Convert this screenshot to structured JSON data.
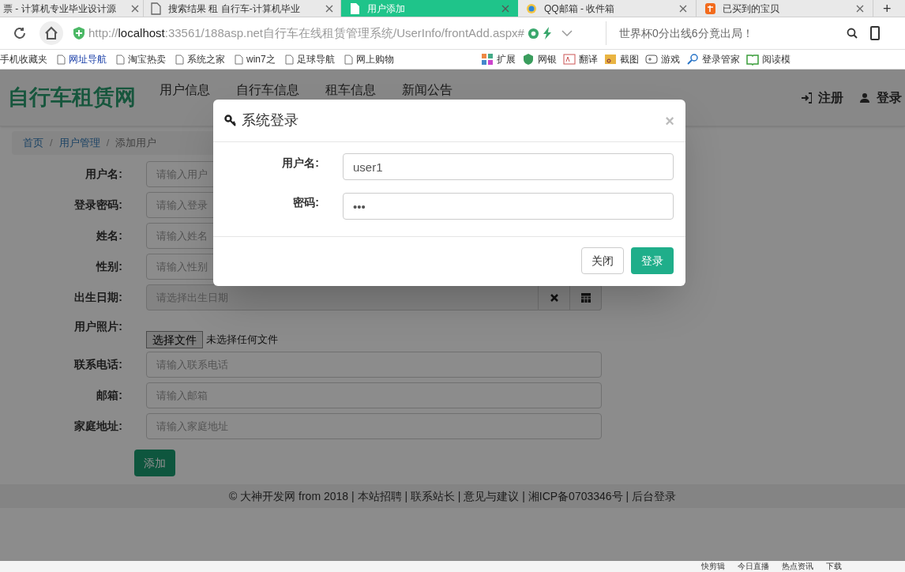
{
  "browser": {
    "tabs": [
      {
        "title": "票 - 计算机专业毕业设计源",
        "kind": "plain",
        "selected": false
      },
      {
        "title": "搜索结果 租 自行车-计算机毕业",
        "kind": "page",
        "selected": false
      },
      {
        "title": "用户添加",
        "kind": "page",
        "selected": true
      },
      {
        "title": "QQ邮箱 - 收件箱",
        "kind": "mail",
        "selected": false
      },
      {
        "title": "已买到的宝贝",
        "kind": "shop",
        "selected": false
      }
    ],
    "new_tab": "+",
    "address": {
      "scheme": "http://",
      "host": "localhost",
      "path": ":33561/188asp.net自行车在线租赁管理系统/UserInfo/frontAdd.aspx#"
    },
    "search_hint": "世界杯0分出线6分竟出局！",
    "bookmarks": [
      {
        "label": "手机收藏夹",
        "kind": "plain"
      },
      {
        "label": "网址导航",
        "kind": "link"
      },
      {
        "label": "淘宝热卖",
        "kind": "page"
      },
      {
        "label": "系统之家",
        "kind": "page"
      },
      {
        "label": "win7之",
        "kind": "page"
      },
      {
        "label": "足球导航",
        "kind": "page"
      },
      {
        "label": "网上购物",
        "kind": "page"
      }
    ],
    "tools": [
      {
        "label": "扩展"
      },
      {
        "label": "网银"
      },
      {
        "label": "翻译"
      },
      {
        "label": "截图"
      },
      {
        "label": "游戏"
      },
      {
        "label": "登录管家"
      },
      {
        "label": "阅读模"
      }
    ],
    "status_bar": [
      "快剪辑",
      "今日直播",
      "热点资讯",
      "下载"
    ]
  },
  "site": {
    "brand": "自行车租赁网",
    "nav": [
      "用户信息",
      "自行车信息",
      "租车信息",
      "新闻公告"
    ],
    "nav_right": [
      {
        "label": "注册"
      },
      {
        "label": "登录"
      }
    ],
    "breadcrumb": [
      "首页",
      "用户管理",
      "添加用户"
    ],
    "breadcrumb_separator": "/",
    "form": [
      {
        "label": "用户名:",
        "kind": "text",
        "placeholder": "请输入用户"
      },
      {
        "label": "登录密码:",
        "kind": "text",
        "placeholder": "请输入登录"
      },
      {
        "label": "姓名:",
        "kind": "text",
        "placeholder": "请输入姓名"
      },
      {
        "label": "性别:",
        "kind": "text",
        "placeholder": "请输入性别"
      },
      {
        "label": "出生日期:",
        "kind": "date",
        "placeholder": "请选择出生日期"
      },
      {
        "label": "用户照片:",
        "kind": "file",
        "button": "选择文件",
        "status": "未选择任何文件"
      },
      {
        "label": "联系电话:",
        "kind": "text",
        "placeholder": "请输入联系电话"
      },
      {
        "label": "邮箱:",
        "kind": "text",
        "placeholder": "请输入邮箱"
      },
      {
        "label": "家庭地址:",
        "kind": "text",
        "placeholder": "请输入家庭地址"
      }
    ],
    "submit": "添加",
    "footer": "© 大神开发网 from 2018 | 本站招聘 | 联系站长 | 意见与建议 | 湘ICP备0703346号 | 后台登录"
  },
  "modal": {
    "title": "系统登录",
    "close": "×",
    "fields": [
      {
        "label": "用户名:",
        "value": "user1"
      },
      {
        "label": "密码:",
        "value": "•••"
      }
    ],
    "buttons": [
      {
        "label": "关闭",
        "kind": "default"
      },
      {
        "label": "登录",
        "kind": "primary"
      }
    ]
  }
}
